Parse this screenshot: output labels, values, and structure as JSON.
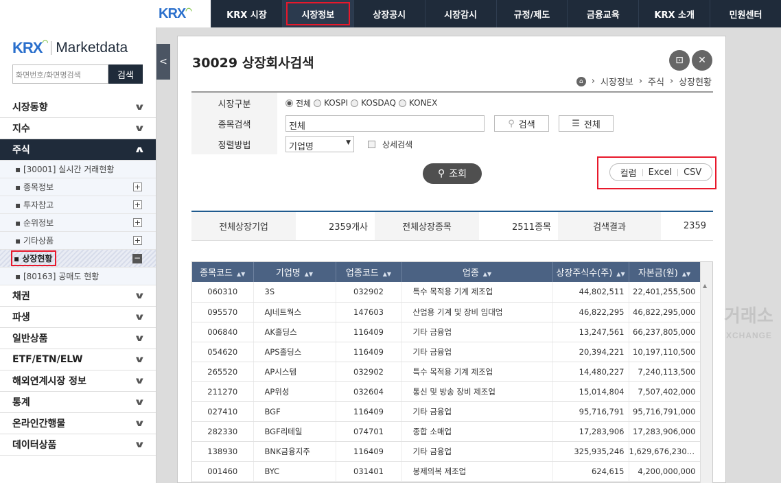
{
  "topnav": {
    "logo": "KRX",
    "items": [
      "KRX 시장",
      "시장정보",
      "상장공시",
      "시장감시",
      "규정/제도",
      "금융교육",
      "KRX 소개",
      "민원센터"
    ]
  },
  "sidebar": {
    "brand": "KRX",
    "brand_sub": "Marketdata",
    "search_placeholder": "화면번호/화면명검색",
    "search_button": "검색",
    "menu_top": [
      "시장동향",
      "지수"
    ],
    "menu_open": "주식",
    "submenu": [
      {
        "label": "[30001] 실시간 거래현황"
      },
      {
        "label": "종목정보"
      },
      {
        "label": "투자참고"
      },
      {
        "label": "순위정보"
      },
      {
        "label": "기타상품"
      },
      {
        "label": "상장현황"
      },
      {
        "label": "[80163] 공매도 현황"
      }
    ],
    "menu_bottom": [
      "채권",
      "파생",
      "일반상품",
      "ETF/ETN/ELW",
      "해외연계시장 정보",
      "통계",
      "온라인간행물",
      "데이터상품"
    ]
  },
  "page": {
    "title": "30029 상장회사검색",
    "breadcrumb": [
      "시장정보",
      "주식",
      "상장현황"
    ]
  },
  "form": {
    "market_label": "시장구분",
    "market_options": [
      "전체",
      "KOSPI",
      "KOSDAQ",
      "KONEX"
    ],
    "market_selected": "전체",
    "stock_label": "종목검색",
    "stock_value": "전체",
    "search_button": "검색",
    "all_button": "전체",
    "sort_label": "정렬방법",
    "sort_value": "기업명",
    "detail_search": "상세검색",
    "query_button": "조회",
    "export": [
      "컬럼",
      "Excel",
      "CSV"
    ]
  },
  "summary": {
    "total_companies_label": "전체상장기업",
    "total_companies": "2359개사",
    "total_stocks_label": "전체상장종목",
    "total_stocks": "2511종목",
    "result_label": "검색결과",
    "result": "2359"
  },
  "table": {
    "headers": [
      "종목코드",
      "기업명",
      "업종코드",
      "업종",
      "상장주식수(주)",
      "자본금(원)"
    ],
    "rows": [
      [
        "060310",
        "3S",
        "032902",
        "특수 목적용 기계 제조업",
        "44,802,511",
        "22,401,255,500"
      ],
      [
        "095570",
        "AJ네트웍스",
        "147603",
        "산업용 기계 및 장비 임대업",
        "46,822,295",
        "46,822,295,000"
      ],
      [
        "006840",
        "AK홀딩스",
        "116409",
        "기타 금융업",
        "13,247,561",
        "66,237,805,000"
      ],
      [
        "054620",
        "APS홀딩스",
        "116409",
        "기타 금융업",
        "20,394,221",
        "10,197,110,500"
      ],
      [
        "265520",
        "AP시스템",
        "032902",
        "특수 목적용 기계 제조업",
        "14,480,227",
        "7,240,113,500"
      ],
      [
        "211270",
        "AP위성",
        "032604",
        "통신 및 방송 장비 제조업",
        "15,014,804",
        "7,507,402,000"
      ],
      [
        "027410",
        "BGF",
        "116409",
        "기타 금융업",
        "95,716,791",
        "95,716,791,000"
      ],
      [
        "282330",
        "BGF리테일",
        "074701",
        "종합 소매업",
        "17,283,906",
        "17,283,906,000"
      ],
      [
        "138930",
        "BNK금융지주",
        "116409",
        "기타 금융업",
        "325,935,246",
        "1,629,676,230,..."
      ],
      [
        "001460",
        "BYC",
        "031401",
        "봉제의복 제조업",
        "624,615",
        "4,200,000,000"
      ]
    ]
  },
  "watermark": {
    "line1": "거래소",
    "line2": "XCHANGE"
  }
}
